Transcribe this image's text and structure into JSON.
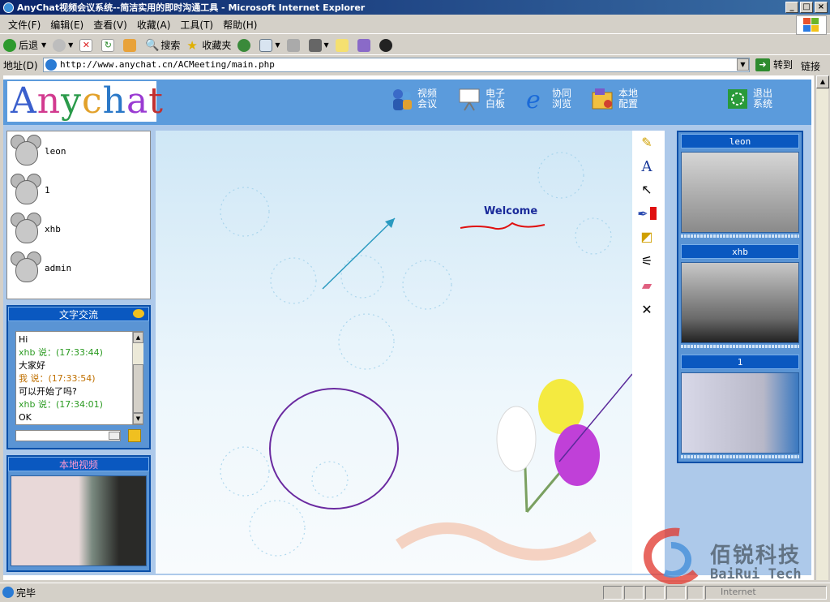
{
  "window": {
    "title": "AnyChat视频会议系统--简洁实用的即时沟通工具 - Microsoft Internet Explorer"
  },
  "menu": [
    "文件(F)",
    "编辑(E)",
    "查看(V)",
    "收藏(A)",
    "工具(T)",
    "帮助(H)"
  ],
  "toolbar": {
    "back": "后退",
    "search": "搜索",
    "favorites": "收藏夹"
  },
  "address": {
    "label": "地址(D)",
    "url": "http://www.anychat.cn/ACMeeting/main.php",
    "go": "转到",
    "links": "链接"
  },
  "logo": "Anychat",
  "nav": [
    {
      "l1": "视频",
      "l2": "会议"
    },
    {
      "l1": "电子",
      "l2": "白板"
    },
    {
      "l1": "协同",
      "l2": "浏览"
    },
    {
      "l1": "本地",
      "l2": "配置"
    },
    {
      "l1": "退出",
      "l2": "系统"
    }
  ],
  "users": [
    "leon",
    "1",
    "xhb",
    "admin"
  ],
  "chat": {
    "title": "文字交流",
    "messages": [
      {
        "text": "Hi",
        "type": "msg"
      },
      {
        "text": "xhb  说：(17:33:44)",
        "type": "meta-green"
      },
      {
        "text": "大家好",
        "type": "msg"
      },
      {
        "text": "我  说：(17:33:54)",
        "type": "meta-orange"
      },
      {
        "text": "可以开始了吗?",
        "type": "msg"
      },
      {
        "text": "xhb  说：(17:34:01)",
        "type": "meta-green"
      },
      {
        "text": "OK",
        "type": "msg"
      }
    ]
  },
  "local_video": {
    "title": "本地视频"
  },
  "whiteboard": {
    "welcome": "Welcome"
  },
  "videos": [
    "leon",
    "xhb",
    "1"
  ],
  "status": {
    "text": "完毕",
    "zone": "Internet"
  },
  "watermark": {
    "cn": "佰锐科技",
    "en": "BaiRui Tech"
  }
}
